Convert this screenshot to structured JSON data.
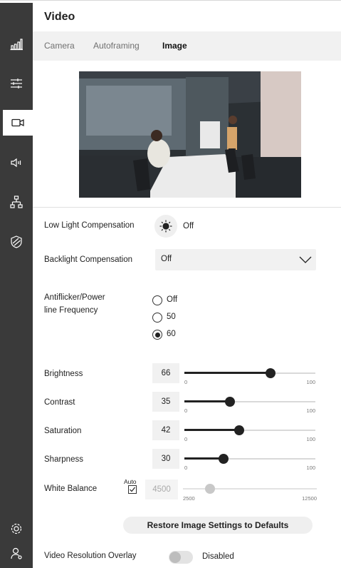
{
  "page": {
    "title": "Video"
  },
  "tabs": [
    {
      "label": "Camera",
      "active": false
    },
    {
      "label": "Autoframing",
      "active": false
    },
    {
      "label": "Image",
      "active": true
    }
  ],
  "sidebar": {
    "items": [
      {
        "icon": "bar-chart-icon",
        "active": false
      },
      {
        "icon": "sliders-icon",
        "active": false
      },
      {
        "icon": "video-camera-icon",
        "active": true
      },
      {
        "icon": "speaker-icon",
        "active": false
      },
      {
        "icon": "network-icon",
        "active": false
      },
      {
        "icon": "shield-icon",
        "active": false
      }
    ],
    "bottom": [
      {
        "icon": "gear-icon"
      },
      {
        "icon": "user-icon"
      }
    ]
  },
  "low_light": {
    "label": "Low Light Compensation",
    "icon": "sun-icon",
    "value": "Off"
  },
  "backlight": {
    "label": "Backlight Compensation",
    "value": "Off"
  },
  "antiflicker": {
    "label_line1": "Antiflicker/Power",
    "label_line2": "line Frequency",
    "options": [
      "Off",
      "50",
      "60"
    ],
    "selected": "60"
  },
  "sliders": {
    "min_label": "0",
    "max_label": "100",
    "items": [
      {
        "label": "Brightness",
        "value": "66",
        "fraction": 0.66
      },
      {
        "label": "Contrast",
        "value": "35",
        "fraction": 0.35
      },
      {
        "label": "Saturation",
        "value": "42",
        "fraction": 0.42
      },
      {
        "label": "Sharpness",
        "value": "30",
        "fraction": 0.3
      }
    ]
  },
  "white_balance": {
    "label": "White Balance",
    "auto_label": "Auto",
    "auto_checked": true,
    "value": "4500",
    "min_label": "2500",
    "max_label": "12500",
    "fraction": 0.2
  },
  "restore_button": "Restore Image Settings to Defaults",
  "overlay": {
    "label": "Video Resolution Overlay",
    "state": "Disabled"
  },
  "colors": {
    "sidebar": "#3a3a3a",
    "tabbar": "#f1f1f1",
    "accent": "#222222"
  }
}
